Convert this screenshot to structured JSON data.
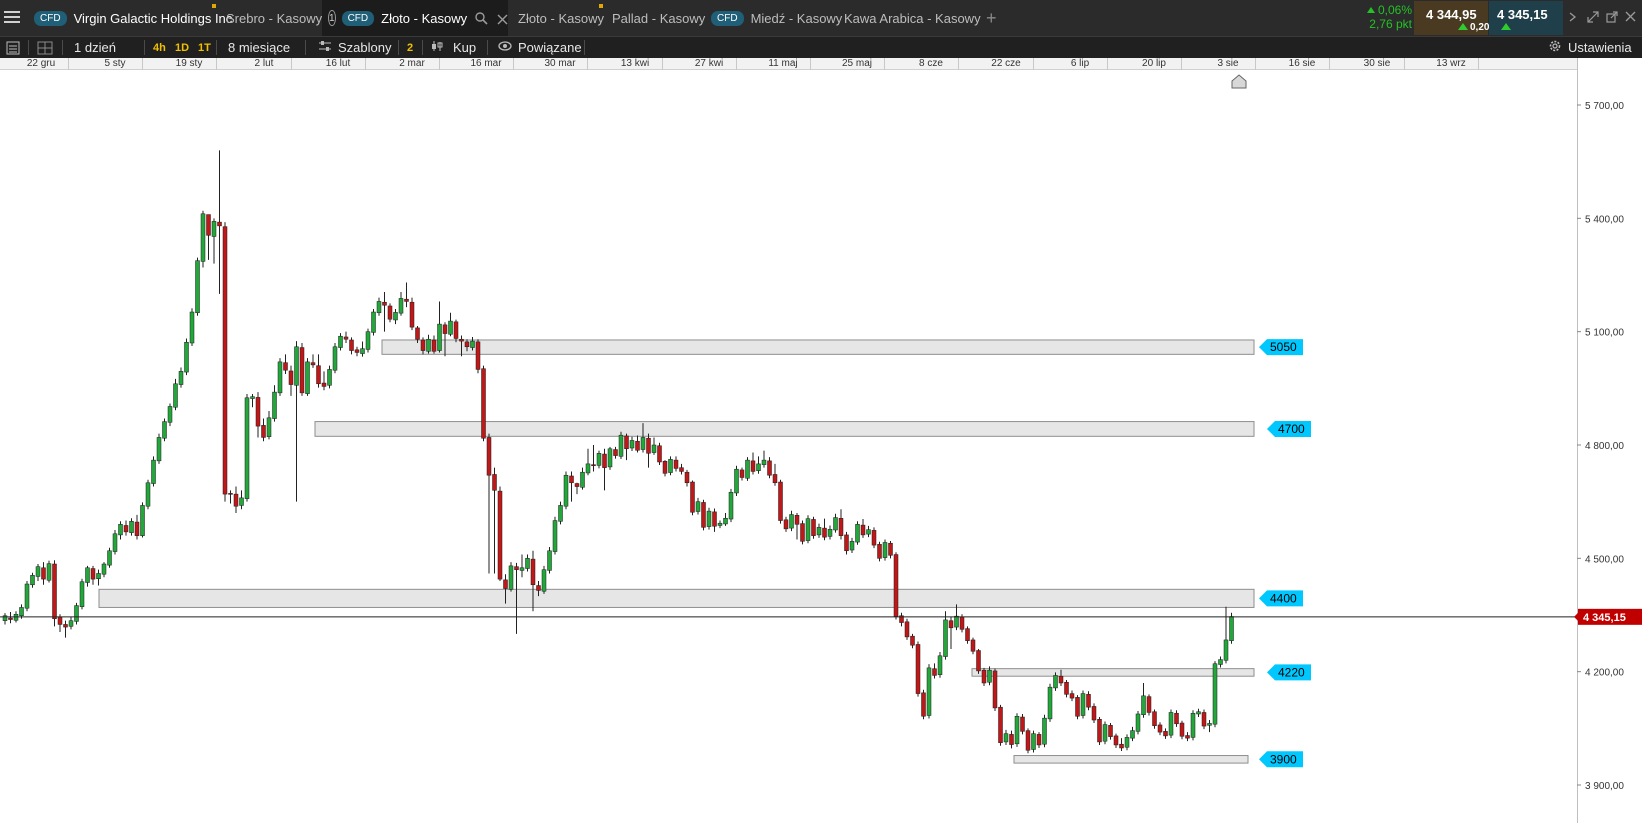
{
  "tabs": [
    {
      "label": "Virgin Galactic Holdings Inc",
      "cfd": "CFD",
      "active": false
    },
    {
      "label": "Srebro - Kasowy",
      "cfd": "",
      "active": false
    },
    {
      "label": "Złoto - Kasowy",
      "cfd": "CFD",
      "active": true,
      "number": "1"
    },
    {
      "label": "Złoto - Kasowy",
      "cfd": "",
      "active": false
    },
    {
      "label": "Pallad - Kasowy",
      "cfd": "",
      "active": false
    },
    {
      "label": "Miedź - Kasowy",
      "cfd": "CFD",
      "active": false
    },
    {
      "label": "Kawa Arabica - Kasowy",
      "cfd": "",
      "active": false
    }
  ],
  "quote": {
    "change_pct": "0,06%",
    "change_pts": "2,76 pkt",
    "sell": "4 344,95",
    "buy": "4 345,15",
    "spread": "0,20"
  },
  "toolbar": {
    "interval": "1 dzień",
    "tf_4h": "4h",
    "tf_1d": "1D",
    "tf_1t": "1T",
    "range": "8 miesiące",
    "templates": "Szablony",
    "templates_count": "2",
    "buy": "Kup",
    "related": "Powiązane",
    "settings": "Ustawienia"
  },
  "date_axis": [
    "22 gru",
    "5 sty",
    "19 sty",
    "2 lut",
    "16 lut",
    "2 mar",
    "16 mar",
    "30 mar",
    "13 kwi",
    "27 kwi",
    "11 maj",
    "25 maj",
    "8 cze",
    "22 cze",
    "6 lip",
    "20 lip",
    "3 sie",
    "16 sie",
    "30 sie",
    "13 wrz"
  ],
  "price_axis": [
    "5 700,00",
    "5 400,00",
    "5 100,00",
    "4 800,00",
    "4 500,00",
    "4 200,00",
    "3 900,00"
  ],
  "current_price_label": "4 345,15",
  "colors": {
    "up": "#22a83a",
    "down": "#c01818",
    "accent": "#00c8ff",
    "current": "#c00000"
  },
  "chart_data": {
    "type": "candlestick",
    "title": "",
    "xlabel": "",
    "ylabel": "",
    "ylim": [
      3820,
      5800
    ],
    "current_price": 4345.15,
    "zones": [
      {
        "label": "5050",
        "low": 5040,
        "high": 5078
      },
      {
        "label": "4700",
        "low": 4823,
        "high": 4862
      },
      {
        "label": "4400",
        "low": 4370,
        "high": 4418
      },
      {
        "label": "4220",
        "low": 4188,
        "high": 4208
      },
      {
        "label": "3900",
        "low": 3958,
        "high": 3978
      }
    ],
    "candles": [
      [
        4335,
        4348,
        4325,
        4355
      ],
      [
        4342,
        4338,
        4328,
        4358
      ],
      [
        4336,
        4352,
        4330,
        4360
      ],
      [
        4348,
        4370,
        4340,
        4378
      ],
      [
        4368,
        4432,
        4360,
        4440
      ],
      [
        4430,
        4455,
        4422,
        4462
      ],
      [
        4452,
        4478,
        4440,
        4485
      ],
      [
        4475,
        4445,
        4430,
        4490
      ],
      [
        4442,
        4486,
        4436,
        4494
      ],
      [
        4485,
        4340,
        4320,
        4495
      ],
      [
        4345,
        4325,
        4305,
        4352
      ],
      [
        4325,
        4318,
        4290,
        4335
      ],
      [
        4320,
        4335,
        4312,
        4345
      ],
      [
        4333,
        4375,
        4325,
        4382
      ],
      [
        4372,
        4438,
        4365,
        4446
      ],
      [
        4436,
        4475,
        4425,
        4480
      ],
      [
        4473,
        4445,
        4430,
        4480
      ],
      [
        4446,
        4460,
        4428,
        4470
      ],
      [
        4458,
        4485,
        4450,
        4490
      ],
      [
        4482,
        4520,
        4475,
        4528
      ],
      [
        4518,
        4565,
        4510,
        4575
      ],
      [
        4562,
        4590,
        4550,
        4598
      ],
      [
        4587,
        4570,
        4560,
        4600
      ],
      [
        4568,
        4598,
        4560,
        4606
      ],
      [
        4596,
        4560,
        4550,
        4615
      ],
      [
        4560,
        4640,
        4555,
        4648
      ],
      [
        4638,
        4700,
        4630,
        4708
      ],
      [
        4698,
        4760,
        4690,
        4770
      ],
      [
        4758,
        4820,
        4750,
        4830
      ],
      [
        4818,
        4862,
        4810,
        4870
      ],
      [
        4860,
        4902,
        4850,
        4910
      ],
      [
        4900,
        4962,
        4892,
        4975
      ],
      [
        4960,
        4995,
        4952,
        5005
      ],
      [
        4993,
        5072,
        4985,
        5082
      ],
      [
        5070,
        5152,
        5062,
        5162
      ],
      [
        5150,
        5288,
        5142,
        5296
      ],
      [
        5286,
        5412,
        5270,
        5420
      ],
      [
        5410,
        5355,
        5290,
        5365
      ],
      [
        5352,
        5392,
        5280,
        5400
      ],
      [
        5390,
        5380,
        5200,
        5580
      ],
      [
        5378,
        4670,
        4650,
        5390
      ],
      [
        4672,
        4670,
        4645,
        4680
      ],
      [
        4670,
        4638,
        4620,
        4690
      ],
      [
        4640,
        4660,
        4630,
        4680
      ],
      [
        4658,
        4925,
        4650,
        4935
      ],
      [
        4923,
        4928,
        4900,
        4935
      ],
      [
        4926,
        4850,
        4820,
        4940
      ],
      [
        4852,
        4820,
        4810,
        4870
      ],
      [
        4822,
        4872,
        4815,
        4890
      ],
      [
        4870,
        4940,
        4862,
        4958
      ],
      [
        4938,
        5020,
        4930,
        5030
      ],
      [
        5018,
        4998,
        4988,
        5040
      ],
      [
        4996,
        4960,
        4930,
        5010
      ],
      [
        4958,
        5060,
        4650,
        5075
      ],
      [
        5058,
        4938,
        4930,
        5070
      ],
      [
        4936,
        5020,
        4930,
        5030
      ],
      [
        5018,
        5012,
        5004,
        5040
      ],
      [
        5010,
        4962,
        4952,
        5040
      ],
      [
        4964,
        4955,
        4945,
        4995
      ],
      [
        4958,
        5000,
        4950,
        5010
      ],
      [
        4998,
        5060,
        4990,
        5070
      ],
      [
        5058,
        5088,
        5050,
        5096
      ],
      [
        5086,
        5080,
        5070,
        5100
      ],
      [
        5078,
        5050,
        5040,
        5085
      ],
      [
        5052,
        5045,
        5035,
        5060
      ],
      [
        5042,
        5055,
        5034,
        5074
      ],
      [
        5053,
        5100,
        5045,
        5108
      ],
      [
        5098,
        5152,
        5090,
        5160
      ],
      [
        5150,
        5180,
        5142,
        5190
      ],
      [
        5178,
        5170,
        5100,
        5205
      ],
      [
        5168,
        5133,
        5125,
        5175
      ],
      [
        5131,
        5151,
        5120,
        5160
      ],
      [
        5149,
        5188,
        5142,
        5205
      ],
      [
        5186,
        5180,
        5165,
        5230
      ],
      [
        5178,
        5112,
        5104,
        5190
      ],
      [
        5110,
        5080,
        5070,
        5115
      ],
      [
        5078,
        5050,
        5040,
        5085
      ],
      [
        5048,
        5080,
        5042,
        5092
      ],
      [
        5078,
        5048,
        5042,
        5090
      ],
      [
        5050,
        5120,
        5045,
        5180
      ],
      [
        5118,
        5095,
        5035,
        5125
      ],
      [
        5093,
        5128,
        5088,
        5150
      ],
      [
        5126,
        5082,
        5072,
        5132
      ],
      [
        5080,
        5075,
        5035,
        5090
      ],
      [
        5073,
        5060,
        5048,
        5080
      ],
      [
        5058,
        5075,
        5050,
        5086
      ],
      [
        5073,
        5000,
        4990,
        5080
      ],
      [
        5002,
        4818,
        4810,
        5010
      ],
      [
        4820,
        4720,
        4460,
        4830
      ],
      [
        4722,
        4680,
        4460,
        4740
      ],
      [
        4678,
        4445,
        4440,
        4690
      ],
      [
        4443,
        4420,
        4380,
        4458
      ],
      [
        4418,
        4480,
        4412,
        4490
      ],
      [
        4478,
        4470,
        4300,
        4488
      ],
      [
        4468,
        4475,
        4450,
        4510
      ],
      [
        4473,
        4500,
        4465,
        4510
      ],
      [
        4498,
        4430,
        4360,
        4520
      ],
      [
        4428,
        4415,
        4400,
        4440
      ],
      [
        4413,
        4470,
        4406,
        4480
      ],
      [
        4468,
        4520,
        4460,
        4530
      ],
      [
        4518,
        4600,
        4510,
        4610
      ],
      [
        4598,
        4640,
        4590,
        4650
      ],
      [
        4638,
        4720,
        4630,
        4730
      ],
      [
        4718,
        4700,
        4650,
        4730
      ],
      [
        4698,
        4690,
        4670,
        4700
      ],
      [
        4688,
        4728,
        4682,
        4740
      ],
      [
        4726,
        4750,
        4720,
        4790
      ],
      [
        4748,
        4745,
        4730,
        4800
      ],
      [
        4746,
        4778,
        4738,
        4785
      ],
      [
        4776,
        4740,
        4680,
        4790
      ],
      [
        4742,
        4790,
        4734,
        4795
      ],
      [
        4788,
        4772,
        4764,
        4795
      ],
      [
        4770,
        4826,
        4763,
        4835
      ],
      [
        4824,
        4790,
        4760,
        4830
      ],
      [
        4792,
        4812,
        4784,
        4822
      ],
      [
        4810,
        4786,
        4780,
        4825
      ],
      [
        4788,
        4820,
        4780,
        4858
      ],
      [
        4818,
        4778,
        4740,
        4830
      ],
      [
        4780,
        4800,
        4774,
        4820
      ],
      [
        4798,
        4755,
        4747,
        4806
      ],
      [
        4757,
        4725,
        4717,
        4760
      ],
      [
        4727,
        4762,
        4720,
        4770
      ],
      [
        4760,
        4738,
        4730,
        4770
      ],
      [
        4740,
        4730,
        4722,
        4750
      ],
      [
        4728,
        4700,
        4690,
        4734
      ],
      [
        4702,
        4622,
        4614,
        4706
      ],
      [
        4624,
        4650,
        4616,
        4660
      ],
      [
        4648,
        4582,
        4574,
        4655
      ],
      [
        4584,
        4625,
        4576,
        4634
      ],
      [
        4623,
        4585,
        4570,
        4632
      ],
      [
        4587,
        4593,
        4580,
        4600
      ],
      [
        4591,
        4606,
        4586,
        4620
      ],
      [
        4604,
        4675,
        4596,
        4684
      ],
      [
        4673,
        4736,
        4665,
        4745
      ],
      [
        4734,
        4714,
        4706,
        4740
      ],
      [
        4712,
        4760,
        4705,
        4768
      ],
      [
        4758,
        4730,
        4722,
        4780
      ],
      [
        4732,
        4750,
        4724,
        4770
      ],
      [
        4748,
        4760,
        4740,
        4785
      ],
      [
        4758,
        4720,
        4712,
        4768
      ],
      [
        4722,
        4700,
        4692,
        4750
      ],
      [
        4702,
        4600,
        4592,
        4708
      ],
      [
        4602,
        4578,
        4570,
        4610
      ],
      [
        4580,
        4616,
        4572,
        4626
      ],
      [
        4614,
        4590,
        4550,
        4620
      ],
      [
        4592,
        4545,
        4537,
        4600
      ],
      [
        4547,
        4605,
        4540,
        4614
      ],
      [
        4603,
        4560,
        4552,
        4610
      ],
      [
        4562,
        4582,
        4554,
        4592
      ],
      [
        4580,
        4556,
        4548,
        4605
      ],
      [
        4558,
        4577,
        4550,
        4587
      ],
      [
        4575,
        4608,
        4568,
        4618
      ],
      [
        4606,
        4560,
        4550,
        4630
      ],
      [
        4562,
        4520,
        4510,
        4570
      ],
      [
        4522,
        4545,
        4514,
        4554
      ],
      [
        4543,
        4590,
        4536,
        4598
      ],
      [
        4588,
        4562,
        4554,
        4604
      ],
      [
        4564,
        4576,
        4556,
        4586
      ],
      [
        4574,
        4535,
        4527,
        4582
      ],
      [
        4537,
        4500,
        4492,
        4544
      ],
      [
        4502,
        4542,
        4494,
        4550
      ],
      [
        4540,
        4508,
        4500,
        4546
      ],
      [
        4510,
        4346,
        4338,
        4516
      ],
      [
        4348,
        4330,
        4320,
        4356
      ],
      [
        4332,
        4292,
        4284,
        4340
      ],
      [
        4294,
        4270,
        4262,
        4300
      ],
      [
        4272,
        4142,
        4134,
        4280
      ],
      [
        4144,
        4082,
        4074,
        4152
      ],
      [
        4084,
        4210,
        4076,
        4220
      ],
      [
        4208,
        4190,
        4182,
        4222
      ],
      [
        4192,
        4242,
        4184,
        4252
      ],
      [
        4240,
        4337,
        4232,
        4360
      ],
      [
        4335,
        4316,
        4260,
        4346
      ],
      [
        4318,
        4347,
        4310,
        4378
      ],
      [
        4345,
        4312,
        4304,
        4352
      ],
      [
        4314,
        4282,
        4274,
        4320
      ],
      [
        4284,
        4254,
        4246,
        4290
      ],
      [
        4256,
        4202,
        4194,
        4260
      ],
      [
        4204,
        4170,
        4162,
        4210
      ],
      [
        4172,
        4204,
        4164,
        4214
      ],
      [
        4202,
        4104,
        4096,
        4208
      ],
      [
        4106,
        4012,
        4004,
        4112
      ],
      [
        4014,
        4036,
        4006,
        4046
      ],
      [
        4034,
        4007,
        3997,
        4044
      ],
      [
        4009,
        4082,
        4001,
        4090
      ],
      [
        4080,
        4042,
        4034,
        4088
      ],
      [
        4044,
        3992,
        3984,
        4050
      ],
      [
        3994,
        4036,
        3986,
        4044
      ],
      [
        4034,
        4006,
        3998,
        4040
      ],
      [
        4008,
        4077,
        4000,
        4086
      ],
      [
        4075,
        4159,
        4067,
        4168
      ],
      [
        4157,
        4190,
        4149,
        4198
      ],
      [
        4188,
        4170,
        4162,
        4205
      ],
      [
        4172,
        4140,
        4132,
        4178
      ],
      [
        4142,
        4130,
        4122,
        4150
      ],
      [
        4132,
        4082,
        4074,
        4138
      ],
      [
        4084,
        4142,
        4076,
        4150
      ],
      [
        4140,
        4106,
        4098,
        4148
      ],
      [
        4108,
        4072,
        4064,
        4116
      ],
      [
        4074,
        4014,
        4006,
        4080
      ],
      [
        4016,
        4060,
        4008,
        4068
      ],
      [
        4058,
        4028,
        4020,
        4064
      ],
      [
        4030,
        4006,
        3998,
        4036
      ],
      [
        4008,
        3998,
        3990,
        4024
      ],
      [
        4000,
        4026,
        3992,
        4034
      ],
      [
        4024,
        4044,
        4016,
        4054
      ],
      [
        4042,
        4088,
        4034,
        4096
      ],
      [
        4086,
        4136,
        4078,
        4170
      ],
      [
        4134,
        4092,
        4084,
        4140
      ],
      [
        4094,
        4057,
        4049,
        4100
      ],
      [
        4059,
        4040,
        4032,
        4066
      ],
      [
        4042,
        4030,
        4022,
        4050
      ],
      [
        4032,
        4092,
        4024,
        4100
      ],
      [
        4090,
        4062,
        4054,
        4098
      ],
      [
        4064,
        4029,
        4021,
        4070
      ],
      [
        4031,
        4024,
        4016,
        4040
      ],
      [
        4026,
        4090,
        4018,
        4098
      ],
      [
        4088,
        4094,
        4080,
        4102
      ],
      [
        4092,
        4056,
        4048,
        4100
      ],
      [
        4058,
        4063,
        4040,
        4072
      ],
      [
        4061,
        4221,
        4053,
        4228
      ],
      [
        4219,
        4232,
        4211,
        4240
      ],
      [
        4230,
        4284,
        4222,
        4372
      ],
      [
        4282,
        4346,
        4274,
        4356
      ]
    ]
  }
}
